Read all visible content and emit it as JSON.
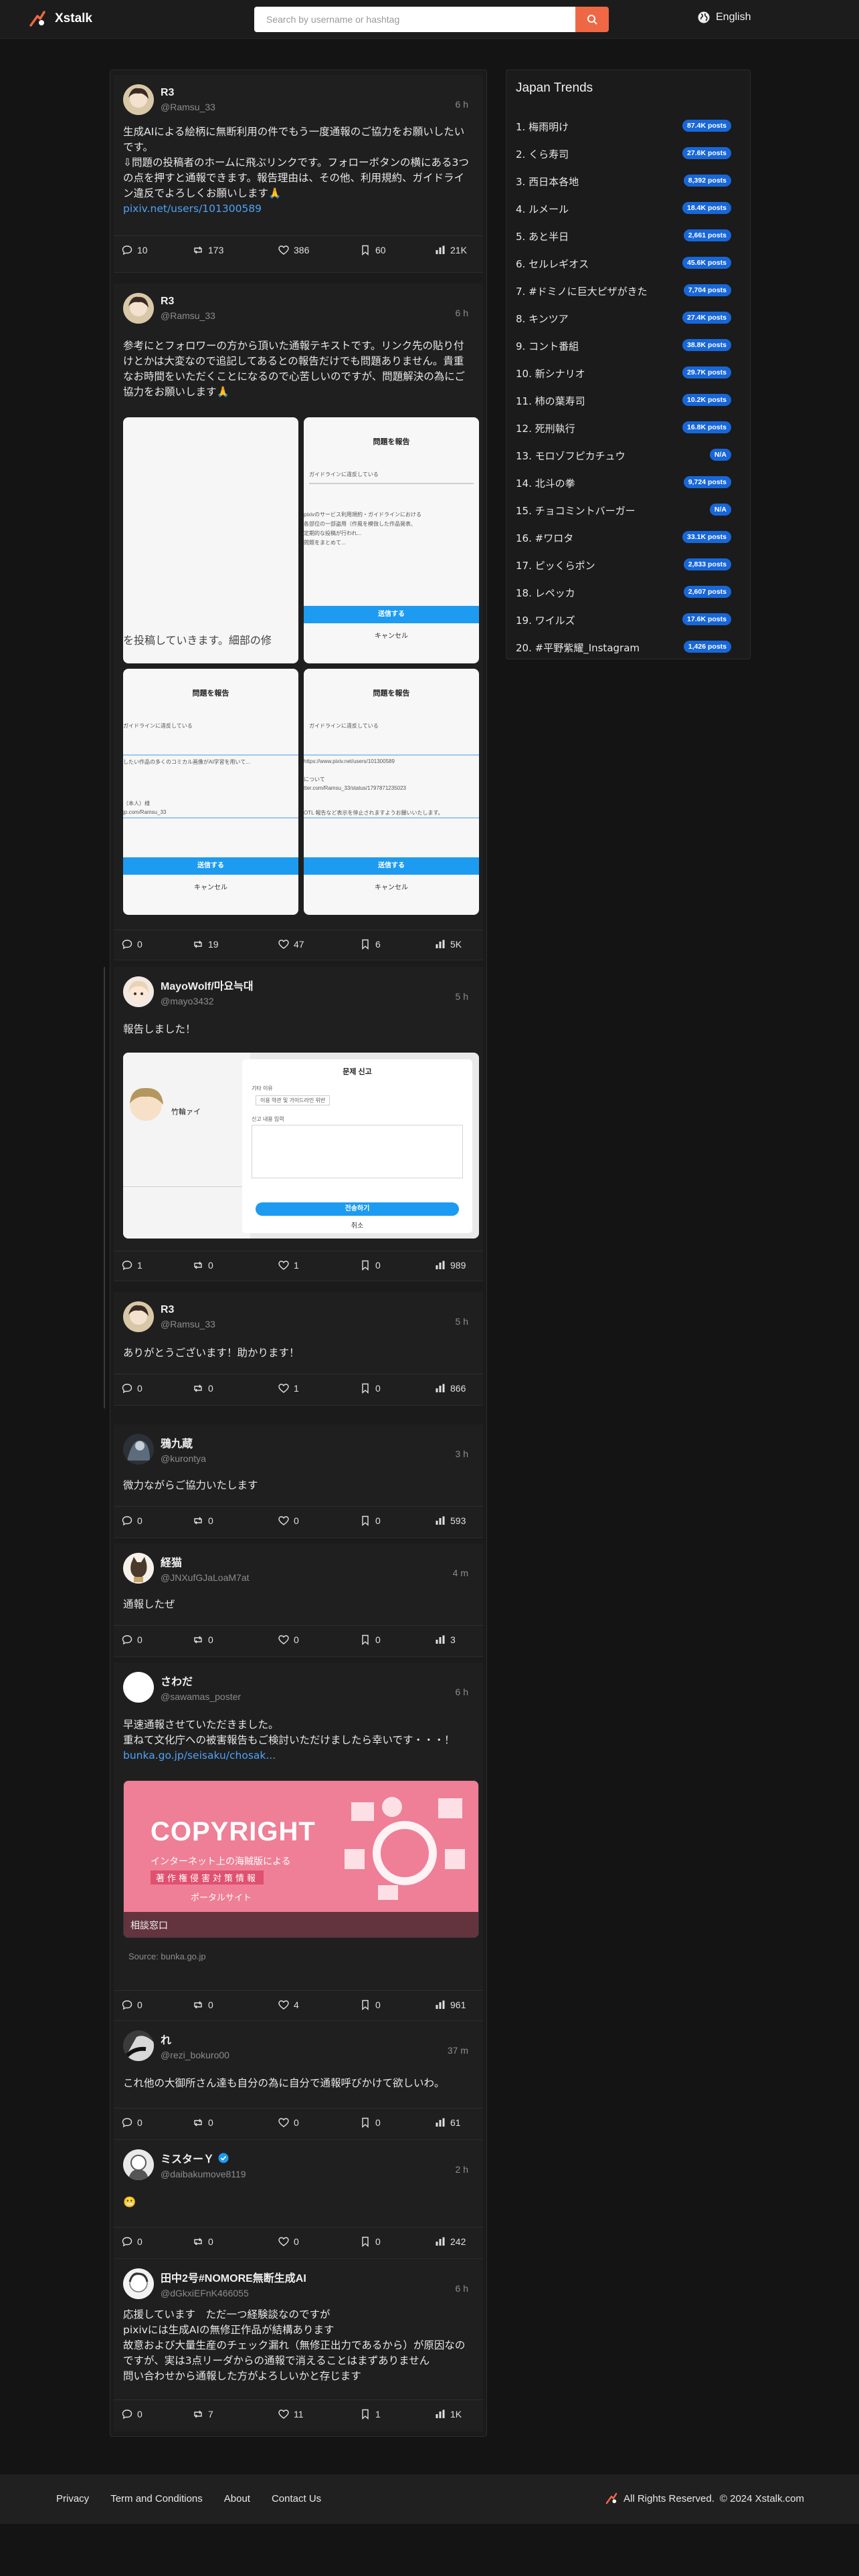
{
  "header": {
    "app_name": "Xstalk",
    "search_placeholder": "Search by username or hashtag",
    "language": "English"
  },
  "colors": {
    "accent": "#ef6845",
    "badge": "#1867d8",
    "link": "#4ea3f5"
  },
  "posts": [
    {
      "name": "R3",
      "handle": "@Ramsu_33",
      "time": "6 h",
      "text": "生成AIによる絵柄に無断利用の件でもう一度通報のご協力をお願いしたいです。\n⇩問題の投稿者のホームに飛ぶリンクです。フォローボタンの横にある3つの点を押すと通報できます。報告理由は、その他、利用規約、ガイドライン違反でよろしくお願いします🙏",
      "link": "pixiv.net/users/101300589",
      "metrics": {
        "replies": "10",
        "reposts": "173",
        "likes": "386",
        "bookmarks": "60",
        "views": "21K"
      }
    },
    {
      "name": "R3",
      "handle": "@Ramsu_33",
      "time": "6 h",
      "text": "参考にとフォロワーの方から頂いた通報テキストです。リンク先の貼り付けとかは大変なので追記してあるとの報告だけでも問題ありません。貴重なお時間をいただくことになるので心苦しいのですが、問題解決の為にご協力をお願いします🙏",
      "images": {
        "partial_text": "を投稿していきます。細部の修",
        "dialog_title": "問題を報告",
        "violation": "ガイドラインに違反している",
        "submit": "送信する",
        "cancel": "キャンセル",
        "lines_a": [
          "pixivのサービス利用規約・ガイドラインにおける",
          "各部位の一部盗用（作風を模倣した作品発表、",
          "定期的な投稿が行われ...",
          "問題をまとめて..."
        ],
        "lines_b": [
          "したい作品の多くのコミカル画像がAI学習を用いて...",
          "https://www.pixiv.net/users/101300589",
          "（本人）様",
          "jp.com/Ramsu_33"
        ],
        "lines_c": [
          "について",
          "tter.com/Ramsu_33/status/1797871235023",
          "OTL 報告など表示を停止されますようお願いいたします。"
        ]
      },
      "metrics": {
        "replies": "0",
        "reposts": "19",
        "likes": "47",
        "bookmarks": "6",
        "views": "5K"
      }
    },
    {
      "name": "MayoWolf/마요늑대",
      "handle": "@mayo3432",
      "time": "5 h",
      "text": "報告しました！",
      "image": {
        "profile_name": "竹輪ァイ",
        "dialog_title": "문제 신고",
        "row1": "기타 이유",
        "row2": "이용 약관 및 가이드라인 위반",
        "row3": "신고 내용 입력",
        "submit": "전송하기",
        "cancel": "취소"
      },
      "metrics": {
        "replies": "1",
        "reposts": "0",
        "likes": "1",
        "bookmarks": "0",
        "views": "989"
      }
    },
    {
      "name": "R3",
      "handle": "@Ramsu_33",
      "time": "5 h",
      "text": "ありがとうございます！助かります！",
      "metrics": {
        "replies": "0",
        "reposts": "0",
        "likes": "1",
        "bookmarks": "0",
        "views": "866"
      }
    },
    {
      "name": "鴉九蔵",
      "handle": "@kurontya",
      "time": "3 h",
      "text": "微力ながらご協力いたします",
      "metrics": {
        "replies": "0",
        "reposts": "0",
        "likes": "0",
        "bookmarks": "0",
        "views": "593"
      }
    },
    {
      "name": "経猫",
      "handle": "@JNXufGJaLoaM7at",
      "time": "4 m",
      "text": "通報したぜ",
      "metrics": {
        "replies": "0",
        "reposts": "0",
        "likes": "0",
        "bookmarks": "0",
        "views": "3"
      }
    },
    {
      "name": "さわだ",
      "handle": "@sawamas_poster",
      "time": "6 h",
      "text": "早速通報させていただきました。\n重ねて文化庁への被害報告もご検討いただけましたら幸いです・・・！",
      "link": "bunka.go.jp/seisaku/chosak...",
      "card": {
        "headline": "COPYRIGHT",
        "sub1": "インターネット上の海賊版による",
        "sub2": "著作権侵害対策情報",
        "sub3": "ポータルサイト",
        "caption": "相談窓口",
        "source": "Source: bunka.go.jp"
      },
      "metrics": {
        "replies": "0",
        "reposts": "0",
        "likes": "4",
        "bookmarks": "0",
        "views": "961"
      }
    },
    {
      "name": "れ",
      "handle": "@rezi_bokuro00",
      "time": "37 m",
      "text": "これ他の大御所さん達も自分の為に自分で通報呼びかけて欲しいわ。",
      "metrics": {
        "replies": "0",
        "reposts": "0",
        "likes": "0",
        "bookmarks": "0",
        "views": "61"
      }
    },
    {
      "name": "ミスターＹ",
      "handle": "@daibakumove8119",
      "time": "2 h",
      "text": "😬",
      "metrics": {
        "replies": "0",
        "reposts": "0",
        "likes": "0",
        "bookmarks": "0",
        "views": "242"
      }
    },
    {
      "name": "田中2号#NOMORE無断生成AI",
      "handle": "@dGkxiEFnK466055",
      "time": "6 h",
      "text": "応援しています　ただ一つ経験談なのですが\npixivには生成AIの無修正作品が結構あります\n故意および大量生産のチェック漏れ（無修正出力であるから）が原因なのですが、実は3点リーダからの通報で消えることはまずありません\n問い合わせから通報した方がよろしいかと存じます",
      "metrics": {
        "replies": "0",
        "reposts": "7",
        "likes": "11",
        "bookmarks": "1",
        "views": "1K"
      }
    }
  ],
  "trends": {
    "title": "Japan Trends",
    "items": [
      {
        "name": "1. 梅雨明け",
        "count": "87.4K posts"
      },
      {
        "name": "2. くら寿司",
        "count": "27.6K posts"
      },
      {
        "name": "3. 西日本各地",
        "count": "8,392 posts"
      },
      {
        "name": "4. ルメール",
        "count": "18.4K posts"
      },
      {
        "name": "5. あと半日",
        "count": "2,661 posts"
      },
      {
        "name": "6. セルレギオス",
        "count": "45.6K posts"
      },
      {
        "name": "7. #ドミノに巨大ピザがきた",
        "count": "7,704 posts"
      },
      {
        "name": "8. キンツア",
        "count": "27.4K posts"
      },
      {
        "name": "9. コント番組",
        "count": "38.8K posts"
      },
      {
        "name": "10. 新シナリオ",
        "count": "29.7K posts"
      },
      {
        "name": "11. 柿の葉寿司",
        "count": "10.2K posts"
      },
      {
        "name": "12. 死刑執行",
        "count": "16.8K posts"
      },
      {
        "name": "13. モロゾフピカチュウ",
        "count": "N/A"
      },
      {
        "name": "14. 北斗の拳",
        "count": "9,724 posts"
      },
      {
        "name": "15. チョコミントバーガー",
        "count": "N/A"
      },
      {
        "name": "16. #ワロタ",
        "count": "33.1K posts"
      },
      {
        "name": "17. ピッくらポン",
        "count": "2,833 posts"
      },
      {
        "name": "18. レペッカ",
        "count": "2,607 posts"
      },
      {
        "name": "19. ワイルズ",
        "count": "17.6K posts"
      },
      {
        "name": "20. #平野紫耀_Instagram",
        "count": "1,426 posts"
      }
    ]
  },
  "footer": {
    "links": [
      "Privacy",
      "Term and Conditions",
      "About",
      "Contact Us"
    ],
    "rights": "All Rights Reserved.",
    "copyright": "© 2024 Xstalk.com"
  }
}
